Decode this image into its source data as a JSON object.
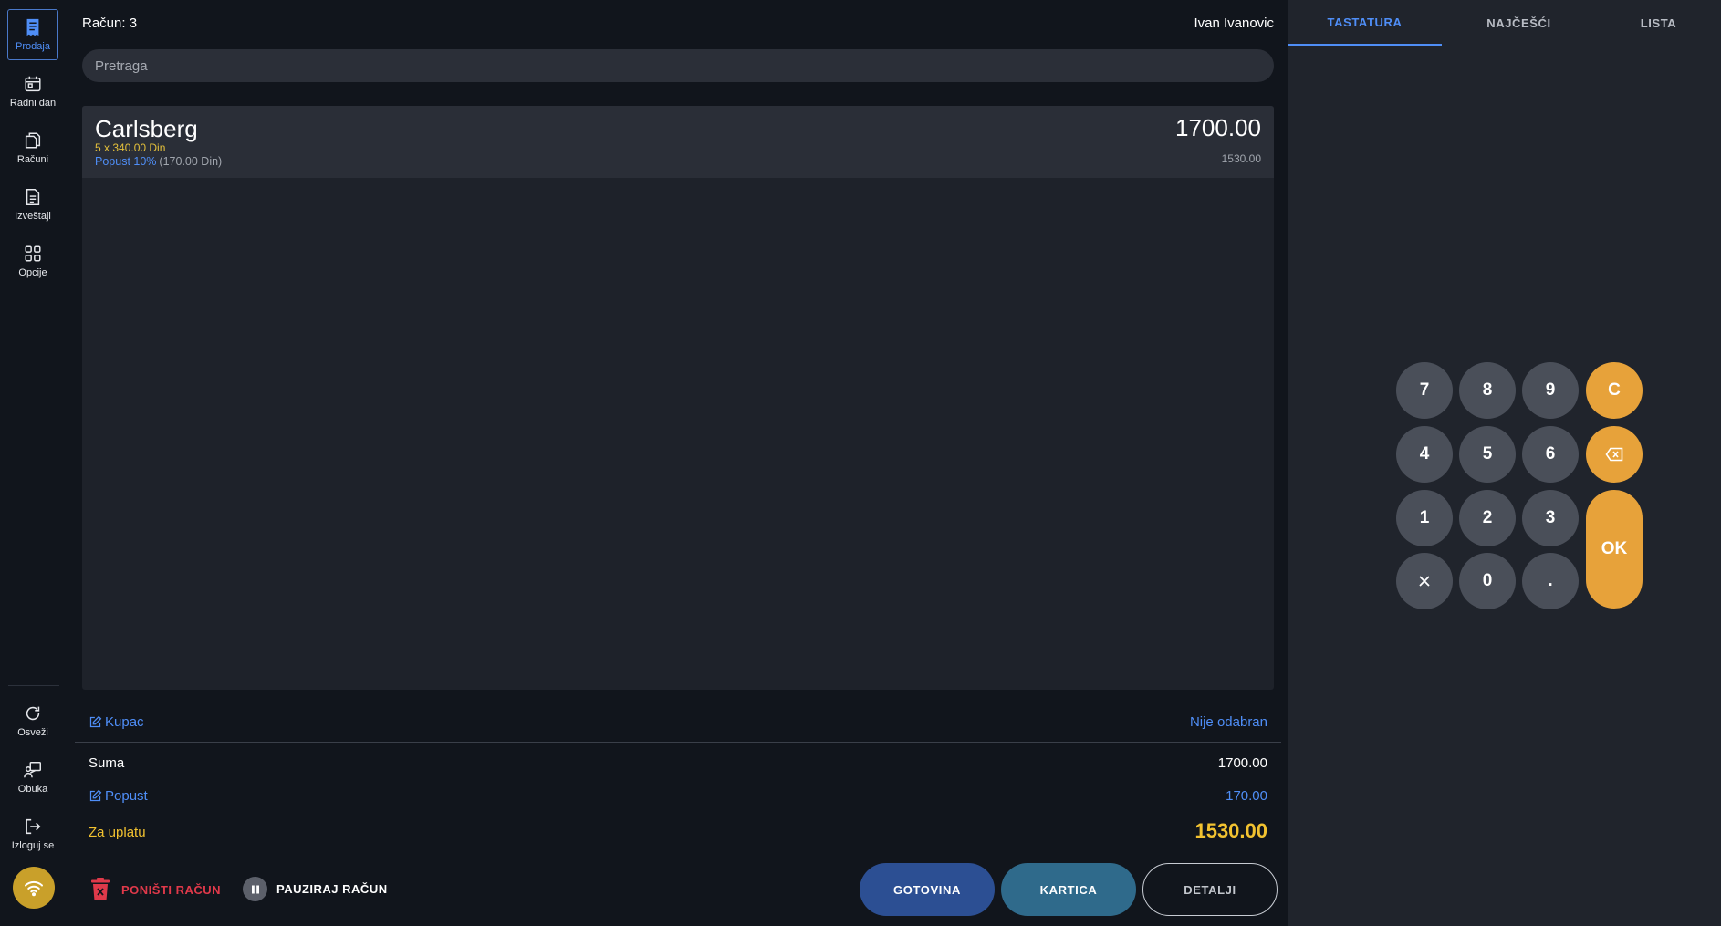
{
  "sidebar": {
    "items": [
      {
        "label": "Prodaja"
      },
      {
        "label": "Radni dan"
      },
      {
        "label": "Računi"
      },
      {
        "label": "Izveštaji"
      },
      {
        "label": "Opcije"
      }
    ],
    "bottom": [
      {
        "label": "Osveži"
      },
      {
        "label": "Obuka"
      },
      {
        "label": "Izloguj se"
      }
    ]
  },
  "header": {
    "receipt": "Račun: 3",
    "user": "Ivan Ivanovic"
  },
  "search": {
    "placeholder": "Pretraga"
  },
  "items": [
    {
      "name": "Carlsberg",
      "qty_line": "5 x 340.00 Din",
      "discount_label": "Popust 10%",
      "discount_amount": "(170.00 Din)",
      "total": "1700.00",
      "net": "1530.00"
    }
  ],
  "summary": {
    "customer_label": "Kupac",
    "customer_value": "Nije odabran",
    "sum_label": "Suma",
    "sum_value": "1700.00",
    "discount_label": "Popust",
    "discount_value": "170.00",
    "pay_label": "Za uplatu",
    "pay_value": "1530.00"
  },
  "actions": {
    "cancel": "PONIŠTI RAČUN",
    "pause": "PAUZIRAJ RAČUN",
    "cash": "GOTOVINA",
    "card": "KARTICA",
    "details": "DETALJI"
  },
  "tabs": [
    "TASTATURA",
    "NAJČEŠĆI",
    "LISTA"
  ],
  "keypad": {
    "k7": "7",
    "k8": "8",
    "k9": "9",
    "clear": "C",
    "k4": "4",
    "k5": "5",
    "k6": "6",
    "k1": "1",
    "k2": "2",
    "k3": "3",
    "ok": "OK",
    "k0": "0",
    "dot": "."
  },
  "colors": {
    "accent_blue": "#4f8ef7",
    "accent_yellow": "#f2c230",
    "accent_orange": "#e7a23a",
    "danger": "#e0394a"
  }
}
